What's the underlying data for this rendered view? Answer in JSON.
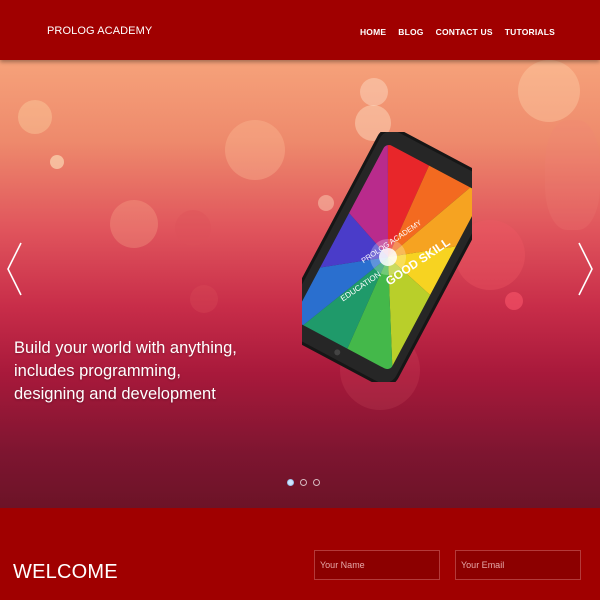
{
  "header": {
    "brand": "PROLOG ACADEMY",
    "nav": [
      "HOME",
      "BLOG",
      "CONTACT US",
      "TUTORIALS"
    ]
  },
  "hero": {
    "caption": "Build your world with anything, includes programming, designing and development",
    "slide_count": 3,
    "active_slide": 1,
    "phone_screen_text": {
      "line1": "PROLOG ACADEMY",
      "line2": "GOOD SKILL",
      "line3": "EDUCATION"
    }
  },
  "welcome": {
    "title": "WELCOME",
    "name_placeholder": "Your Name",
    "email_placeholder": "Your Email"
  },
  "colors": {
    "primary_red": "#a00000",
    "hero_top": "#f6a27a",
    "hero_bottom": "#6c1327"
  }
}
